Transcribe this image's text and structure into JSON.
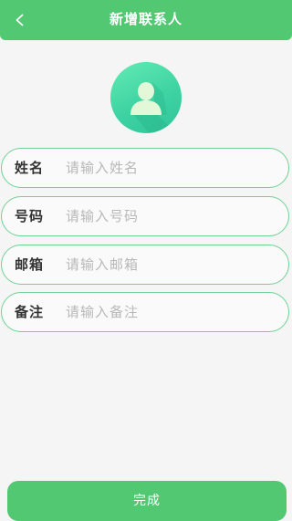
{
  "header": {
    "title": "新增联系人",
    "back_icon": "chevron-left-icon",
    "color": "#52c873"
  },
  "avatar": {
    "icon": "user-avatar-icon",
    "color": "#3ed3a2"
  },
  "form": {
    "fields": [
      {
        "label": "姓名",
        "placeholder": "请输入姓名",
        "value": ""
      },
      {
        "label": "号码",
        "placeholder": "请输入号码",
        "value": ""
      },
      {
        "label": "邮箱",
        "placeholder": "请输入邮箱",
        "value": ""
      },
      {
        "label": "备注",
        "placeholder": "请输入备注",
        "value": ""
      }
    ],
    "border_color": "#6fd294"
  },
  "footer": {
    "done_label": "完成"
  }
}
